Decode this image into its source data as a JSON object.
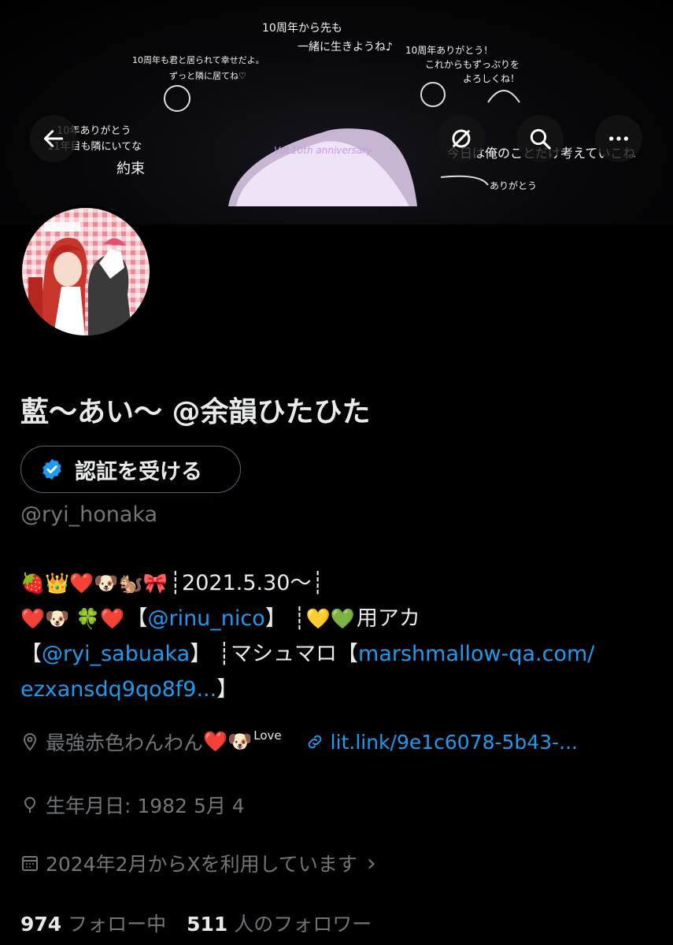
{
  "banner": {
    "messages": [
      "10周年から先も",
      "一緒に生きようね♪",
      "10周年も君と居られて幸せだよ。",
      "ずっと隣に居てね♡",
      "10周年ありがとう！",
      "これからもずっぷりを",
      "よろしくね！",
      "10年ありがとう",
      "11年目も隣にいてな",
      "約束",
      "今日は俺のことだけ考えていこね",
      "ありがとう",
      "Vol.10th anniversary"
    ]
  },
  "profile": {
    "display_name": "藍〜あい〜 @余韻ひたひた",
    "verify_label": "認証を受ける",
    "handle": "@ryi_honaka"
  },
  "bio": {
    "line1_emojis": "🍓👑❤️🐶🐿️🎀",
    "line1_text": "┊2021.5.30〜┊",
    "line2_emojis": "❤️🐶 🍀❤️",
    "line2_bracket_open": "【",
    "line2_mention": "@rinu_nico",
    "line2_bracket_close": "】 ┊",
    "line2_emojis2": "💛💚",
    "line2_text": "用アカ",
    "line3_bracket_open": "【",
    "line3_mention": "@ryi_sabuaka",
    "line3_text": "】 ┊マシュマロ【",
    "line3_link": "marshmallow-qa.com/",
    "line4_link": "ezxansdq9qo8f9...",
    "line4_close": "】"
  },
  "meta": {
    "location": "最強赤色わんわん",
    "location_emojis": "❤️🐶",
    "location_love": "Love",
    "website": "lit.link/9e1c6078-5b43-...",
    "birthday": "生年月日: 1982 5月 4",
    "joined": "2024年2月からXを利用しています",
    "joined_chevron": "›"
  },
  "stats": {
    "following_count": "974",
    "following_label": "フォロー中",
    "followers_count": "511",
    "followers_label": "人のフォロワー"
  },
  "colors": {
    "background": "#000000",
    "text_primary": "#e7e9ea",
    "text_secondary": "#71767b",
    "link": "#1d9bf0",
    "verified_badge": "#1d9bf0"
  },
  "icons": [
    "back-arrow-icon",
    "no-translate-icon",
    "search-icon",
    "more-icon",
    "verified-badge-icon",
    "location-icon",
    "link-icon",
    "birthday-icon",
    "calendar-icon"
  ]
}
